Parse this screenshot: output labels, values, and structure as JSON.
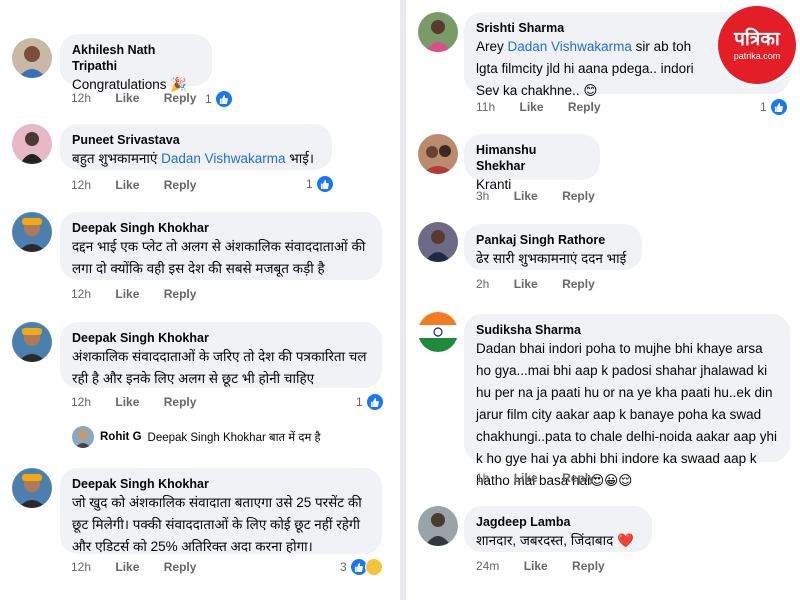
{
  "left": [
    {
      "author": "Akhilesh Nath Tripathi",
      "text": "Congratulations 🎉",
      "time": "12h",
      "like": "Like",
      "reply": "Reply",
      "reactions": "1"
    },
    {
      "author": "Puneet Srivastava",
      "text_before": "बहुत शुभकामनाएं ",
      "mention": "Dadan Vishwakarma",
      "text_after": " भाई।",
      "time": "12h",
      "like": "Like",
      "reply": "Reply",
      "reactions": "1"
    },
    {
      "author": "Deepak Singh Khokhar",
      "text": "दद्दन भाई एक प्लेट तो अलग से अंशकालिक संवाददाताओं की लगा दो क्योंकि वही इस देश की सबसे मजबूत कड़ी है",
      "time": "12h",
      "like": "Like",
      "reply": "Reply"
    },
    {
      "author": "Deepak Singh Khokhar",
      "text": "अंशकालिक संवाददाताओं के जरिए तो देश की पत्रकारिता चल रही है और इनके लिए अलग से छूट भी होनी चाहिए",
      "time": "12h",
      "like": "Like",
      "reply": "Reply",
      "reactions": "1",
      "reply_preview": {
        "author": "Rohit G",
        "text": "Deepak Singh Khokhar बात में दम है"
      }
    },
    {
      "author": "Deepak Singh Khokhar",
      "text": "जो खुद को अंशकालिक संवादाता बताएगा उसे 25 परसेंट की छूट मिलेगी। पक्की संवाददाताओं के लिए कोई छूट नहीं रहेगी और एडिटर्स को 25% अतिरिक्त अदा करना होगा।",
      "time": "12h",
      "like": "Like",
      "reply": "Reply",
      "reactions": "3"
    }
  ],
  "right": [
    {
      "author": "Srishti Sharma",
      "text_before": "Arey ",
      "mention": "Dadan Vishwakarma",
      "text_after": " sir ab toh lgta filmcity jld hi aana pdega.. indori Sev ka chakhne.. 😊",
      "time": "11h",
      "like": "Like",
      "reply": "Reply",
      "reactions": "1"
    },
    {
      "author": "Himanshu Shekhar",
      "text": "Kranti",
      "time": "3h",
      "like": "Like",
      "reply": "Reply"
    },
    {
      "author": "Pankaj Singh Rathore",
      "text": "ढेर सारी शुभकामनाएं ददन भाई",
      "time": "2h",
      "like": "Like",
      "reply": "Reply"
    },
    {
      "author": "Sudiksha Sharma",
      "text": "Dadan bhai indori poha to mujhe bhi khaye arsa ho gya...mai bhi aap k padosi shahar jhalawad ki hu per na ja paati hu or na ye kha paati hu..ek din jarur film city aakar aap k banaye poha ka swad chakhungi..pata to chale delhi-noida aakar aap yhi k ho gye hai ya abhi bhi indore ka swaad aap k hatho mai basa hai😍😀😌",
      "time": "1h",
      "like": "Like",
      "reply": "Reply"
    },
    {
      "author": "Jagdeep Lamba",
      "text": "शानदार, जबरदस्त, जिंदाबाद ❤️",
      "time": "24m",
      "like": "Like",
      "reply": "Reply"
    }
  ],
  "logo": {
    "name": "पत्रिका",
    "site": "patrika.com"
  }
}
